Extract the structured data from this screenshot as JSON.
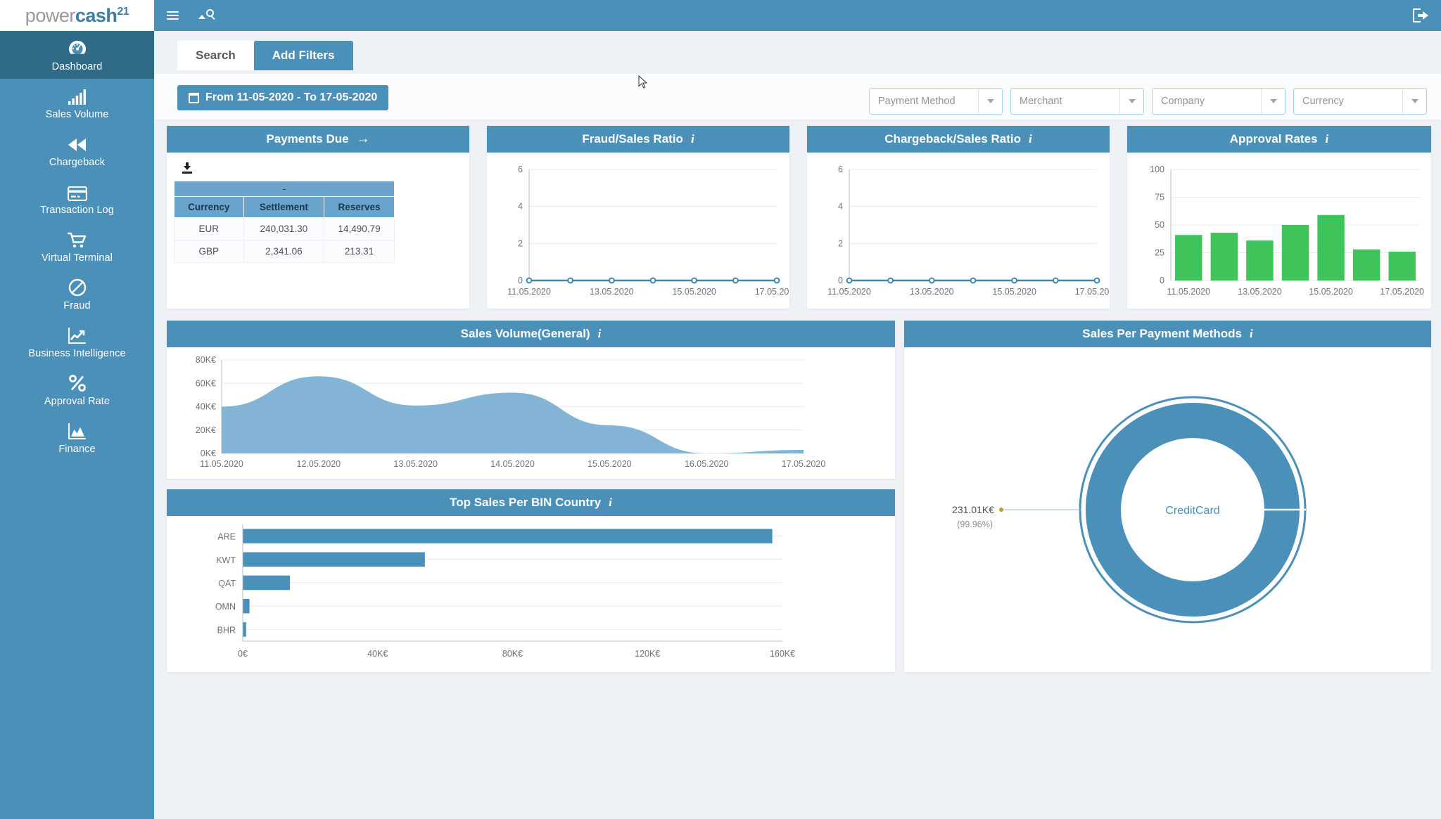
{
  "app": {
    "logo_primary": "power",
    "logo_secondary": "cash",
    "logo_superscript": "21"
  },
  "topbar": {
    "menu_icon": "hamburger-icon",
    "search_icon": "search-icon",
    "logout_icon": "logout-icon"
  },
  "sidebar": {
    "items": [
      {
        "label": "Dashboard",
        "icon": "dashboard-gauge-icon",
        "active": true
      },
      {
        "label": "Sales Volume",
        "icon": "bar-chart-icon",
        "active": false
      },
      {
        "label": "Chargeback",
        "icon": "rewind-icon",
        "active": false
      },
      {
        "label": "Transaction Log",
        "icon": "credit-card-icon",
        "active": false
      },
      {
        "label": "Virtual Terminal",
        "icon": "shopping-cart-icon",
        "active": false
      },
      {
        "label": "Fraud",
        "icon": "no-entry-icon",
        "active": false
      },
      {
        "label": "Business Intelligence",
        "icon": "line-chart-icon",
        "active": false
      },
      {
        "label": "Approval Rate",
        "icon": "percent-icon",
        "active": false
      },
      {
        "label": "Finance",
        "icon": "area-chart-icon",
        "active": false
      }
    ]
  },
  "tabs": [
    {
      "label": "Search",
      "active": false
    },
    {
      "label": "Add Filters",
      "active": true
    }
  ],
  "toolbar": {
    "date_range": "From 11-05-2020 - To 17-05-2020",
    "filters": [
      {
        "placeholder": "Payment Method"
      },
      {
        "placeholder": "Merchant"
      },
      {
        "placeholder": "Company"
      },
      {
        "placeholder": "Currency"
      }
    ]
  },
  "colors": {
    "brand_blue": "#4a90b8",
    "sidebar_active": "#2f6b86",
    "green_bar": "#3fc45c",
    "page_bg": "#eef1f6"
  },
  "cards": {
    "payments_due": {
      "title": "Payments Due",
      "arrow": "→",
      "download_icon": "download-icon",
      "table": {
        "spacer_row": "-",
        "columns": [
          "Currency",
          "Settlement",
          "Reserves"
        ],
        "rows": [
          [
            "EUR",
            "240,031.30",
            "14,490.79"
          ],
          [
            "GBP",
            "2,341.06",
            "213.31"
          ]
        ]
      }
    },
    "fraud_ratio": {
      "title": "Fraud/Sales Ratio",
      "info_icon": "info-icon"
    },
    "chargeback_ratio": {
      "title": "Chargeback/Sales Ratio",
      "info_icon": "info-icon"
    },
    "approval_rates": {
      "title": "Approval Rates",
      "info_icon": "info-icon"
    },
    "sales_volume": {
      "title": "Sales Volume(General)",
      "info_icon": "info-icon"
    },
    "payment_methods": {
      "title": "Sales Per Payment Methods",
      "info_icon": "info-icon"
    },
    "bin_country": {
      "title": "Top Sales Per BIN Country",
      "info_icon": "info-icon"
    }
  },
  "chart_data": [
    {
      "id": "fraud_ratio",
      "type": "line",
      "title": "Fraud/Sales Ratio",
      "x": [
        "11.05.2020",
        "12.05.2020",
        "13.05.2020",
        "14.05.2020",
        "15.05.2020",
        "16.05.2020",
        "17.05.2020"
      ],
      "tick_labels": [
        "11.05.2020",
        "13.05.2020",
        "15.05.2020",
        "17.05.2020"
      ],
      "values": [
        0,
        0,
        0,
        0,
        0,
        0,
        0
      ],
      "ylim": [
        0,
        6
      ],
      "yticks": [
        0,
        2,
        4,
        6
      ],
      "xlabel": "",
      "ylabel": "",
      "grid": true,
      "legend": "none",
      "color": "#3f86b4"
    },
    {
      "id": "chargeback_ratio",
      "type": "line",
      "title": "Chargeback/Sales Ratio",
      "x": [
        "11.05.2020",
        "12.05.2020",
        "13.05.2020",
        "14.05.2020",
        "15.05.2020",
        "16.05.2020",
        "17.05.2020"
      ],
      "tick_labels": [
        "11.05.2020",
        "13.05.2020",
        "15.05.2020",
        "17.05.2020"
      ],
      "values": [
        0,
        0,
        0,
        0,
        0,
        0,
        0
      ],
      "ylim": [
        0,
        6
      ],
      "yticks": [
        0,
        2,
        4,
        6
      ],
      "xlabel": "",
      "ylabel": "",
      "grid": true,
      "legend": "none",
      "color": "#3f86b4"
    },
    {
      "id": "approval_rates",
      "type": "bar",
      "title": "Approval Rates",
      "categories": [
        "11.05.2020",
        "12.05.2020",
        "13.05.2020",
        "14.05.2020",
        "15.05.2020",
        "16.05.2020",
        "17.05.2020"
      ],
      "tick_labels": [
        "11.05.2020",
        "13.05.2020",
        "15.05.2020",
        "17.05.2020"
      ],
      "values": [
        41,
        43,
        36,
        50,
        59,
        28,
        26
      ],
      "ylim": [
        0,
        100
      ],
      "yticks": [
        0,
        25,
        50,
        75,
        100
      ],
      "xlabel": "",
      "ylabel": "",
      "grid": true,
      "legend": "none",
      "color": "#3fc45c"
    },
    {
      "id": "sales_volume",
      "type": "area",
      "title": "Sales Volume(General)",
      "x": [
        "11.05.2020",
        "12.05.2020",
        "13.05.2020",
        "14.05.2020",
        "15.05.2020",
        "16.05.2020",
        "17.05.2020"
      ],
      "tick_labels": [
        "11.05.2020",
        "12.05.2020",
        "13.05.2020",
        "14.05.2020",
        "15.05.2020",
        "16.05.2020",
        "17.05.2020"
      ],
      "values": [
        40000,
        66000,
        41000,
        52000,
        24000,
        0,
        3000
      ],
      "ylim": [
        0,
        80000
      ],
      "yticks": [
        0,
        20000,
        40000,
        60000,
        80000
      ],
      "ytick_labels": [
        "0K€",
        "20K€",
        "40K€",
        "60K€",
        "80K€"
      ],
      "xlabel": "",
      "ylabel": "",
      "grid": true,
      "legend": "none",
      "color": "#78aed2"
    },
    {
      "id": "payment_methods",
      "type": "pie",
      "title": "Sales Per Payment Methods",
      "labels": [
        "CreditCard"
      ],
      "values": [
        231010
      ],
      "value_label": "231.01K€",
      "percent_label": "(99.96%)",
      "center_label": "CreditCard",
      "legend": "none",
      "color": "#4a90b8"
    },
    {
      "id": "bin_country",
      "type": "bar",
      "orientation": "horizontal",
      "title": "Top Sales Per BIN Country",
      "categories": [
        "ARE",
        "KWT",
        "QAT",
        "OMN",
        "BHR"
      ],
      "values": [
        157000,
        54000,
        14000,
        2000,
        1000
      ],
      "xlim": [
        0,
        160000
      ],
      "xticks": [
        0,
        40000,
        80000,
        120000,
        160000
      ],
      "xtick_labels": [
        "0€",
        "40K€",
        "80K€",
        "120K€",
        "160K€"
      ],
      "xlabel": "",
      "ylabel": "",
      "grid": true,
      "legend": "none",
      "color": "#4a90b8"
    }
  ]
}
